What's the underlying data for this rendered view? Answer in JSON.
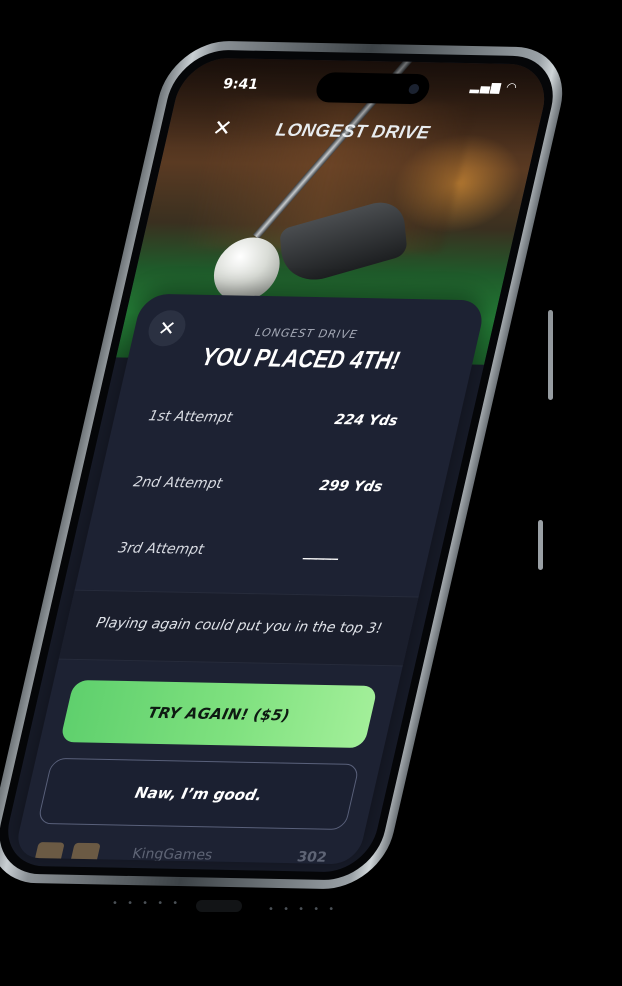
{
  "status_bar": {
    "time": "9:41",
    "signal_icon": "signal-wifi-icon"
  },
  "header": {
    "title": "LONGEST DRIVE",
    "close_icon": "close-icon",
    "close_glyph": "✕"
  },
  "result_card": {
    "close_glyph": "✕",
    "kicker": "LONGEST DRIVE",
    "headline": "YOU PLACED 4TH!",
    "attempts": [
      {
        "label": "1st Attempt",
        "value": "224 Yds"
      },
      {
        "label": "2nd Attempt",
        "value": "299 Yds"
      },
      {
        "label": "3rd Attempt",
        "value": "_____"
      }
    ],
    "tip": "Playing again could put you in the top 3!",
    "primary_button": "TRY AGAIN! ($5)",
    "secondary_button": "Naw, I’m good."
  },
  "leaderboard_peek": {
    "name": "KingGames",
    "score": "302"
  },
  "colors": {
    "card_bg": "#1d2233",
    "accent_green": "#6fdc74",
    "background": "#000000"
  }
}
